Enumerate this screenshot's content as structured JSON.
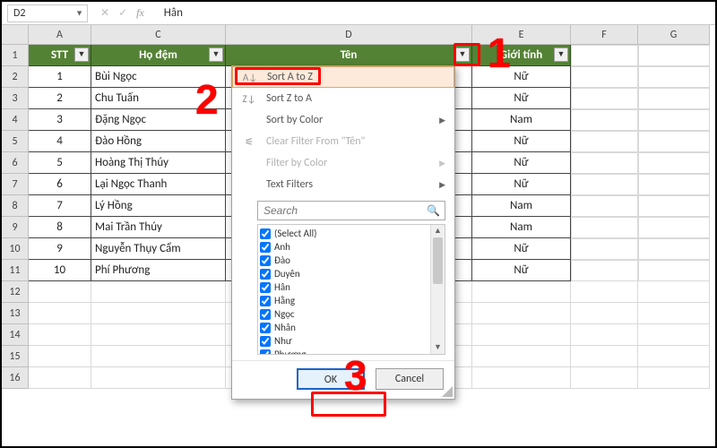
{
  "formula_bar": {
    "cell_ref": "D2",
    "value": "Hân"
  },
  "columns": [
    "A",
    "C",
    "D",
    "E",
    "F",
    "G"
  ],
  "row_numbers": [
    "1",
    "2",
    "3",
    "4",
    "5",
    "6",
    "7",
    "8",
    "9",
    "10",
    "11",
    "12",
    "13",
    "14",
    "15",
    "16"
  ],
  "table": {
    "headers": {
      "A": "STT",
      "C": "Họ đệm",
      "D": "Tên",
      "E": "Giới tính"
    },
    "rows": [
      {
        "stt": "1",
        "hodem": "Bùi Ngọc",
        "gt": "Nữ"
      },
      {
        "stt": "2",
        "hodem": "Chu Tuấn",
        "gt": "Nữ"
      },
      {
        "stt": "3",
        "hodem": "Đặng Ngọc",
        "gt": "Nam"
      },
      {
        "stt": "4",
        "hodem": "Đào Hồng",
        "gt": "Nữ"
      },
      {
        "stt": "5",
        "hodem": "Hoàng Thị Thúy",
        "gt": "Nữ"
      },
      {
        "stt": "6",
        "hodem": "Lại Ngọc Thanh",
        "gt": "Nữ"
      },
      {
        "stt": "7",
        "hodem": "Lý Hồng",
        "gt": "Nam"
      },
      {
        "stt": "8",
        "hodem": "Mai Trần Thúy",
        "gt": "Nam"
      },
      {
        "stt": "9",
        "hodem": "Nguyễn Thụy Cẩm",
        "gt": "Nữ"
      },
      {
        "stt": "10",
        "hodem": "Phí Phương",
        "gt": "Nữ"
      }
    ]
  },
  "filter_menu": {
    "sort_az": "Sort A to Z",
    "sort_za": "Sort Z to A",
    "sort_color": "Sort by Color",
    "clear": "Clear Filter From \"Tên\"",
    "filter_color": "Filter by Color",
    "text_filters": "Text Filters",
    "search_placeholder": "Search",
    "items": [
      "(Select All)",
      "Anh",
      "Đào",
      "Duyên",
      "Hân",
      "Hằng",
      "Ngọc",
      "Nhân",
      "Như",
      "Phương"
    ],
    "ok": "OK",
    "cancel": "Cancel"
  },
  "annotations": {
    "n1": "1",
    "n2": "2",
    "n3": "3"
  }
}
